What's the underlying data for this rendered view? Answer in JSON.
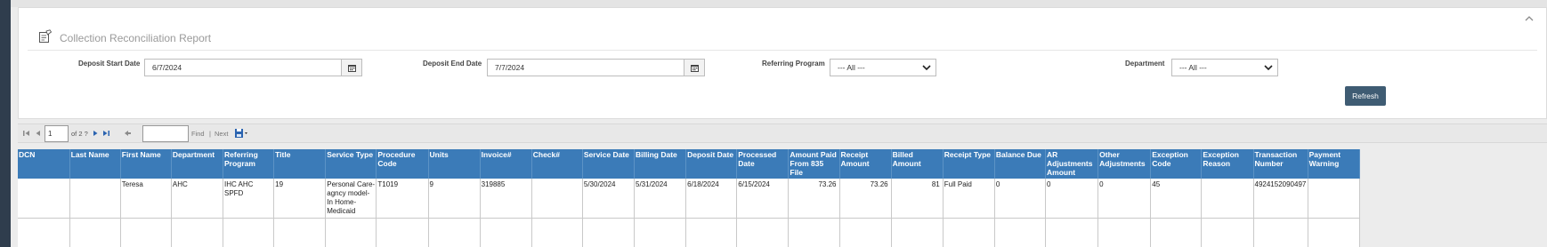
{
  "report": {
    "title": "Collection Reconciliation Report"
  },
  "filters": {
    "deposit_start_label": "Deposit Start Date",
    "deposit_start_value": "6/7/2024",
    "deposit_end_label": "Deposit End Date",
    "deposit_end_value": "7/7/2024",
    "referring_program_label": "Referring Program",
    "referring_program_value": "--- All ---",
    "department_label": "Department",
    "department_value": "--- All ---",
    "refresh_label": "Refresh"
  },
  "toolbar": {
    "page_value": "1",
    "page_of": "of 2 ?",
    "find_label": "Find",
    "separator": "|",
    "next_label": "Next"
  },
  "table": {
    "headers": [
      "DCN",
      "Last Name",
      "First Name",
      "Department",
      "Referring Program",
      "Title",
      "Service Type",
      "Procedure Code",
      "Units",
      "Invoice#",
      "Check#",
      "Service Date",
      "Billing Date",
      "Deposit Date",
      "Processed Date",
      "Amount Paid From 835 File",
      "Receipt Amount",
      "Billed Amount",
      "Receipt Type",
      "Balance Due",
      "AR Adjustments Amount",
      "Other Adjustments",
      "Exception Code",
      "Exception Reason",
      "Transaction Number",
      "Payment Warning"
    ],
    "rows": [
      [
        "",
        "",
        "Teresa",
        "AHC",
        "IHC AHC SPFD",
        "19",
        "Personal Care-agncy model-In Home-Medicaid",
        "T1019",
        "9",
        "319885",
        "",
        "5/30/2024",
        "5/31/2024",
        "6/18/2024",
        "6/15/2024",
        "73.26",
        "73.26",
        "81",
        "Full Paid",
        "0",
        "0",
        "0",
        "45",
        "",
        "4924152090497",
        ""
      ]
    ]
  },
  "colors": {
    "header_blue": "#3b7bb8",
    "refresh_bg": "#3f5c73"
  },
  "icons": [
    "report-edit-icon",
    "calendar-icon",
    "chevron-down-icon",
    "first-page-icon",
    "prev-page-icon",
    "next-page-icon",
    "last-page-icon",
    "back-icon",
    "save-export-icon",
    "collapse-chevron-icon"
  ]
}
